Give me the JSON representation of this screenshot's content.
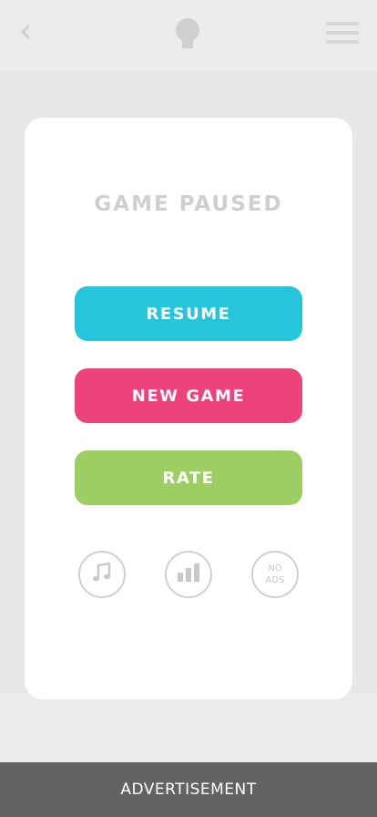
{
  "colors": {
    "resume": "#25c6dc",
    "new_game": "#ee427b",
    "rate": "#9dce64",
    "title": "#cfcfcf",
    "ad_bar": "#636363"
  },
  "header": {
    "left_icon": "back-icon",
    "center_icon": "lightbulb-icon",
    "right_icon": "menu-icon"
  },
  "pause_menu": {
    "title": "GAME PAUSED",
    "resume_label": "RESUME",
    "new_game_label": "NEW GAME",
    "rate_label": "RATE",
    "icons": {
      "music": "music-note-icon",
      "stats": "bar-chart-icon",
      "no_ads_line1": "NO",
      "no_ads_line2": "ADS"
    }
  },
  "ad": {
    "label": "ADVERTISEMENT"
  }
}
